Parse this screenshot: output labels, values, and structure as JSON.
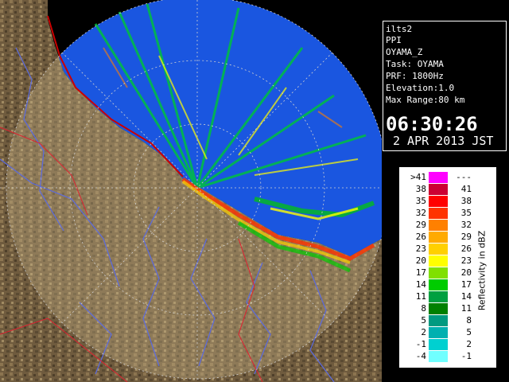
{
  "info": {
    "product": "ilts2",
    "scan_type": "PPI",
    "field": "OYAMA_Z",
    "task": "Task: OYAMA",
    "prf": "PRF: 1800Hz",
    "elevation": "Elevation:1.0",
    "max_range": "Max Range:80 km",
    "time": "06:30:26",
    "date": "2 APR 2013 JST"
  },
  "legend": {
    "title": "Reflectivity in dBZ",
    "rows": [
      {
        "left": ">41",
        "right": "---",
        "color": "#ff00ff"
      },
      {
        "left": "38",
        "right": "41",
        "color": "#cc0033"
      },
      {
        "left": "35",
        "right": "38",
        "color": "#ff0000"
      },
      {
        "left": "32",
        "right": "35",
        "color": "#ff3300"
      },
      {
        "left": "29",
        "right": "32",
        "color": "#ff8000"
      },
      {
        "left": "26",
        "right": "29",
        "color": "#ffaa00"
      },
      {
        "left": "23",
        "right": "26",
        "color": "#ffd000"
      },
      {
        "left": "20",
        "right": "23",
        "color": "#ffff00"
      },
      {
        "left": "17",
        "right": "20",
        "color": "#80e000"
      },
      {
        "left": "14",
        "right": "17",
        "color": "#00cc00"
      },
      {
        "left": "11",
        "right": "14",
        "color": "#00a040"
      },
      {
        "left": "8",
        "right": "11",
        "color": "#008000"
      },
      {
        "left": "5",
        "right": "8",
        "color": "#009a80"
      },
      {
        "left": "2",
        "right": "5",
        "color": "#00b0b0"
      },
      {
        "left": "-1",
        "right": "2",
        "color": "#00d0d0"
      },
      {
        "left": "-4",
        "right": "-1",
        "color": "#70ffff"
      }
    ]
  }
}
